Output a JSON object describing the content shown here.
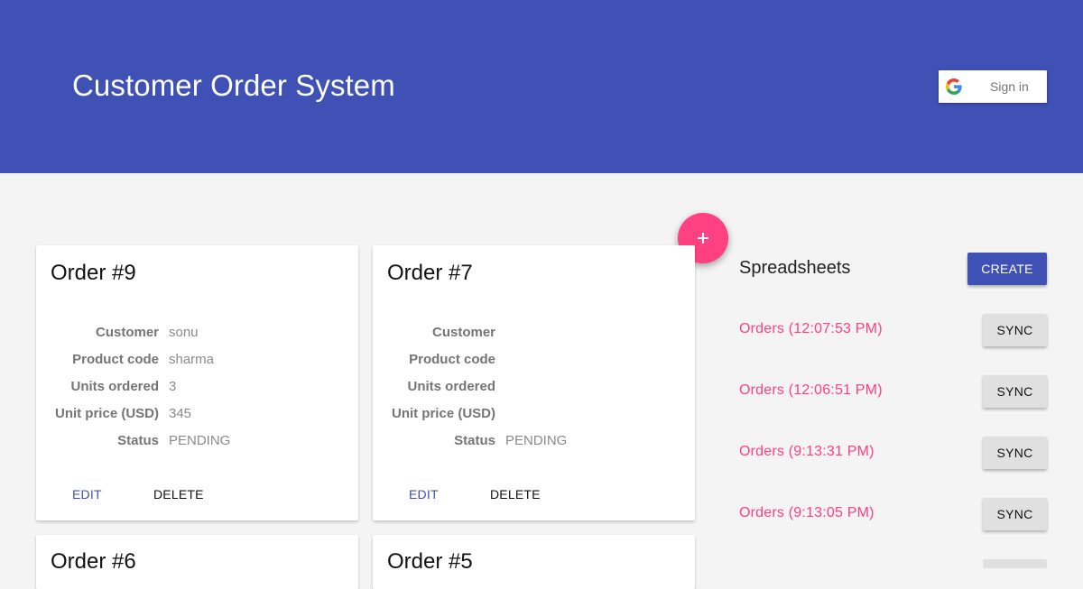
{
  "header": {
    "title": "Customer Order System",
    "signin_label": "Sign in"
  },
  "fab": {
    "icon": "plus-icon",
    "color": "#ff4081"
  },
  "orders": [
    {
      "title": "Order #9",
      "fields": [
        {
          "label": "Customer",
          "value": "sonu"
        },
        {
          "label": "Product code",
          "value": "sharma"
        },
        {
          "label": "Units ordered",
          "value": "3"
        },
        {
          "label": "Unit price (USD)",
          "value": "345"
        },
        {
          "label": "Status",
          "value": "PENDING"
        }
      ],
      "edit_label": "EDIT",
      "delete_label": "DELETE"
    },
    {
      "title": "Order #7",
      "fields": [
        {
          "label": "Customer",
          "value": ""
        },
        {
          "label": "Product code",
          "value": ""
        },
        {
          "label": "Units ordered",
          "value": ""
        },
        {
          "label": "Unit price (USD)",
          "value": ""
        },
        {
          "label": "Status",
          "value": "PENDING"
        }
      ],
      "edit_label": "EDIT",
      "delete_label": "DELETE"
    },
    {
      "title": "Order #6"
    },
    {
      "title": "Order #5"
    }
  ],
  "spreadsheets": {
    "title": "Spreadsheets",
    "create_label": "CREATE",
    "items": [
      {
        "name": "Orders (12:07:53 PM)",
        "sync_label": "SYNC"
      },
      {
        "name": "Orders (12:06:51 PM)",
        "sync_label": "SYNC"
      },
      {
        "name": "Orders (9:13:31 PM)",
        "sync_label": "SYNC"
      },
      {
        "name": "Orders (9:13:05 PM)",
        "sync_label": "SYNC"
      }
    ]
  },
  "colors": {
    "primary": "#3f51b5",
    "accent": "#ff4081",
    "background": "#f4f4f4"
  }
}
